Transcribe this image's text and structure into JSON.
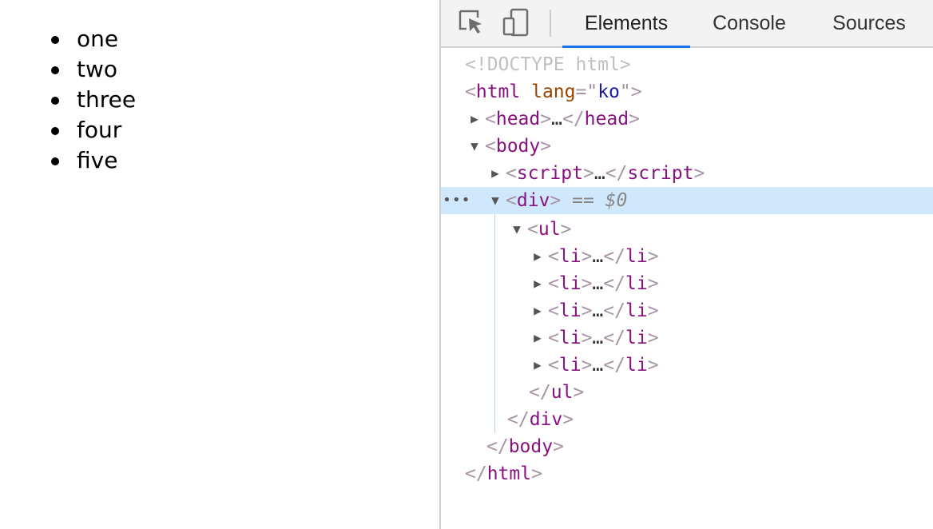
{
  "page": {
    "list_items": [
      "one",
      "two",
      "three",
      "four",
      "five"
    ]
  },
  "devtools": {
    "toolbar": {
      "inspect_icon": "inspect-cursor-icon",
      "device_icon": "device-toolbar-icon",
      "tabs": [
        {
          "label": "Elements",
          "active": true
        },
        {
          "label": "Console",
          "active": false
        },
        {
          "label": "Sources",
          "active": false
        }
      ]
    },
    "tree": {
      "doctype": "<!DOCTYPE html>",
      "html_open_tag": "html",
      "html_attr_name": "lang",
      "html_attr_value": "ko",
      "head_tag": "head",
      "body_tag": "body",
      "script_tag": "script",
      "div_tag": "div",
      "selected_marker": "== $0",
      "ul_tag": "ul",
      "li_tag": "li",
      "ellipsis": "…",
      "more_dots": "•••"
    },
    "colors": {
      "accent": "#1a73e8",
      "selected_row": "#cfe8fc",
      "tag": "#881280",
      "attribute": "#994500",
      "value": "#1a1aa6"
    }
  }
}
